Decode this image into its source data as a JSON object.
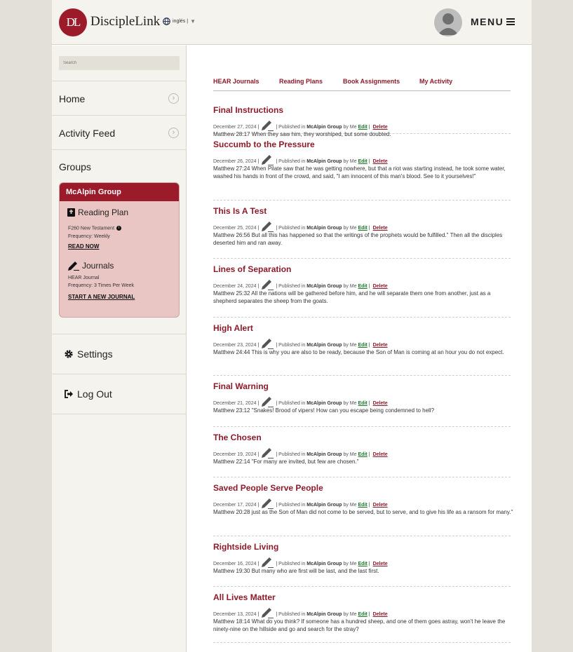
{
  "brand": {
    "name": "DiscipleLink",
    "monogram": "DL"
  },
  "language": {
    "label": "inglés |",
    "caret": "▼"
  },
  "menu": {
    "label": "MENU"
  },
  "sidebar": {
    "search_placeholder": "Search",
    "home": "Home",
    "activity_feed": "Activity Feed",
    "groups": "Groups",
    "group": {
      "name": "McAlpin Group",
      "reading_plan_title": "Reading Plan",
      "reading_plan_name": "F260 New Testament",
      "reading_plan_frequency": "Frequency: Weekly",
      "read_now": "READ NOW",
      "journals_title": "Journals",
      "journal_name": "HEAR Journal",
      "journal_frequency": "Frequency: 3 Times Per Week",
      "start_journal": "START A NEW JOURNAL"
    },
    "settings": "Settings",
    "logout": "Log Out"
  },
  "tabs": [
    "HEAR Journals",
    "Reading Plans",
    "Book Assignments",
    "My Activity"
  ],
  "meta_labels": {
    "published_in": "Published in",
    "by": "by Me",
    "edit": "Edit",
    "delete": "Delete",
    "group": "McAlpin Group"
  },
  "entries": [
    {
      "title": "Final Instructions",
      "date": "December 27, 2024",
      "text": "Matthew 28:17 When they saw him, they worshiped, but some doubted."
    },
    {
      "title": "Succumb to the Pressure",
      "date": "December 26, 2024",
      "text": "Matthew 27:24 When Pilate saw that he was getting nowhere, but that a riot was starting instead, he took some water, washed his hands in front of the crowd, and said, \"I am innocent of this man's blood. See to it yourselves!\""
    },
    {
      "title": "This Is A Test",
      "date": "December 25, 2024",
      "text": "Matthew 26:56 But all this has happened so that the writings of the prophets would be fulfilled.\" Then all the disciples deserted him and ran away."
    },
    {
      "title": "Lines of Separation",
      "date": "December 24, 2024",
      "text": "Matthew 25:32 All the nations will be gathered before him, and he will separate them one from another, just as a shepherd separates the sheep from the goats."
    },
    {
      "title": "High Alert",
      "date": "December 23, 2024",
      "text": "Matthew 24:44 This is why you are also to be ready, because the Son of Man is coming at an hour you do not expect."
    },
    {
      "title": "Final Warning",
      "date": "December 21, 2024",
      "text": "Matthew 23:12 \"Snakes! Brood of vipers! How can you escape being condemned to hell?"
    },
    {
      "title": "The Chosen",
      "date": "December 19, 2024",
      "text": "Matthew 22:14 \"For many are invited, but few are chosen.\""
    },
    {
      "title": "Saved People Serve People",
      "date": "December 17, 2024",
      "text": "Matthew 20:28 just as the Son of Man did not come to be served, but to serve, and to give his life as a ransom for many.\""
    },
    {
      "title": "Rightside Living",
      "date": "December 16, 2024",
      "text": "Matthew 19:30 But many who are first will be last, and the last first."
    },
    {
      "title": "All Lives Matter",
      "date": "December 13, 2024",
      "text": "Matthew 18:14 What do you think? If someone has a hundred sheep, and one of them goes astray, won't he leave the ninety-nine on the hillside and go and search for the stray?"
    }
  ]
}
